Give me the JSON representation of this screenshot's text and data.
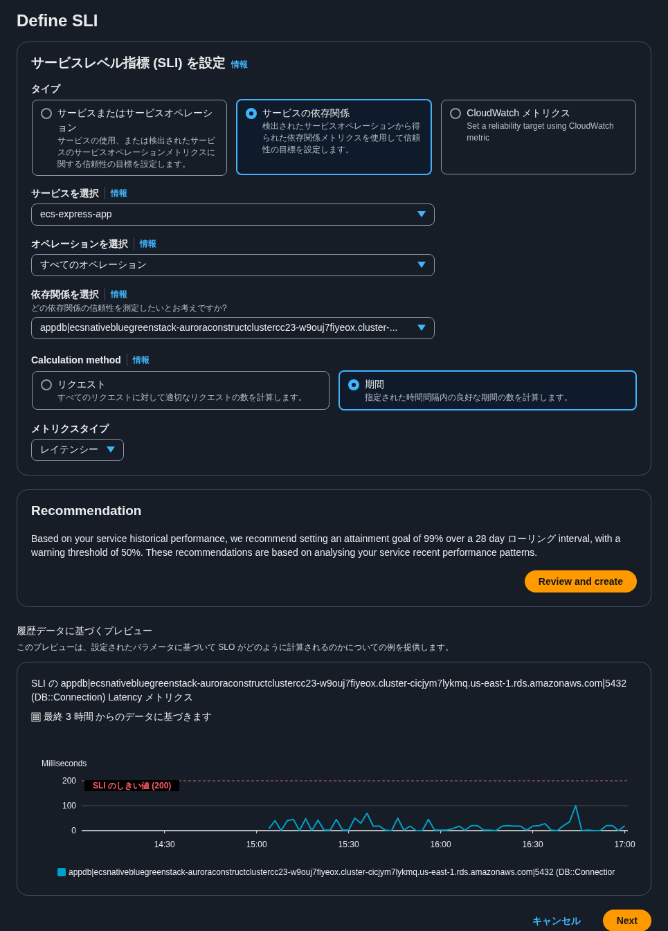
{
  "page_title": "Define SLI",
  "sli_panel": {
    "title": "サービスレベル指標 (SLI) を設定",
    "info": "情報",
    "type_label": "タイプ",
    "type_options": [
      {
        "label": "サービスまたはサービスオペレーション",
        "description": "サービスの使用、または検出されたサービスのサービスオペレーションメトリクスに関する信頼性の目標を設定します。",
        "selected": false
      },
      {
        "label": "サービスの依存関係",
        "description": "検出されたサービスオペレーションから得られた依存関係メトリクスを使用して信頼性の目標を設定します。",
        "selected": true
      },
      {
        "label": "CloudWatch メトリクス",
        "description": "Set a reliability target using CloudWatch metric",
        "selected": false
      }
    ],
    "selects": [
      {
        "label": "サービスを選択",
        "info": "情報",
        "value": "ecs-express-app"
      },
      {
        "label": "オペレーションを選択",
        "info": "情報",
        "value": "すべてのオペレーション"
      },
      {
        "label": "依存関係を選択",
        "info": "情報",
        "hint": "どの依存関係の信頼性を測定したいとお考えですか?",
        "value": "appdb|ecsnativebluegreenstack-auroraconstructclustercc23-w9ouj7fiyeox.cluster-..."
      }
    ],
    "calculation_method": {
      "label": "Calculation method",
      "info": "情報",
      "options": [
        {
          "label": "リクエスト",
          "description": "すべてのリクエストに対して適切なリクエストの数を計算します。",
          "selected": false
        },
        {
          "label": "期間",
          "description": "指定された時間間隔内の良好な期間の数を計算します。",
          "selected": true
        }
      ]
    },
    "metric_type": {
      "label": "メトリクスタイプ",
      "value": "レイテンシー"
    }
  },
  "recommendation": {
    "title": "Recommendation",
    "text": "Based on your service historical performance, we recommend setting an attainment goal of 99% over a 28 day ローリング interval, with a warning threshold of 50%. These recommendations are based on analysing your service recent performance patterns.",
    "button": "Review and create"
  },
  "preview": {
    "title": "履歴データに基づくプレビュー",
    "description": "このプレビューは、設定されたパラメータに基づいて SLO がどのように計算されるのかについての例を提供します。",
    "metric_text": "SLI の appdb|ecsnativebluegreenstack-auroraconstructclustercc23-w9ouj7fiyeox.cluster-cicjym7lykmq.us-east-1.rds.amazonaws.com|5432 (DB::Connection) Latency メトリクス",
    "range_text": "最終 3 時間 からのデータに基づきます",
    "chart_data": {
      "type": "line",
      "ylabel": "Milliseconds",
      "ylim": [
        0,
        200
      ],
      "yticks": [
        0,
        100,
        200
      ],
      "categories": [
        null,
        null,
        null,
        null,
        null,
        null,
        null,
        null,
        null,
        null,
        null,
        null,
        null,
        "14:30",
        null,
        null,
        null,
        null,
        null,
        null,
        null,
        null,
        null,
        null,
        null,
        null,
        null,
        null,
        "15:00",
        null,
        null,
        null,
        null,
        null,
        null,
        null,
        null,
        null,
        null,
        null,
        null,
        null,
        null,
        "15:30",
        null,
        null,
        null,
        null,
        null,
        null,
        null,
        null,
        null,
        null,
        null,
        null,
        null,
        null,
        "16:00",
        null,
        null,
        null,
        null,
        null,
        null,
        null,
        null,
        null,
        null,
        null,
        null,
        null,
        null,
        "16:30",
        null,
        null,
        null,
        null,
        null,
        null,
        null,
        null,
        null,
        null,
        null,
        null,
        null,
        null,
        "17:00"
      ],
      "series": [
        {
          "name": "appdb|ecsnativebluegreenstack-auroraconstructclustercc23-w9ouj7fiyeox.cluster-cicjym7lykmq.us-east-1.rds.amazonaws.com|5432 (DB::Connectior",
          "color": "#00a1c9",
          "values": [
            null,
            null,
            null,
            null,
            null,
            null,
            null,
            null,
            null,
            null,
            null,
            null,
            null,
            null,
            null,
            null,
            null,
            null,
            null,
            null,
            null,
            null,
            null,
            null,
            null,
            null,
            null,
            null,
            null,
            null,
            8,
            40,
            0,
            40,
            45,
            0,
            48,
            0,
            42,
            2,
            2,
            45,
            2,
            2,
            50,
            30,
            70,
            18,
            18,
            2,
            0,
            50,
            2,
            18,
            0,
            0,
            45,
            2,
            2,
            2,
            8,
            18,
            2,
            20,
            20,
            2,
            2,
            0,
            18,
            20,
            18,
            18,
            2,
            18,
            20,
            28,
            2,
            0,
            20,
            35,
            100,
            0,
            2,
            0,
            0,
            20,
            20,
            0,
            20
          ]
        }
      ],
      "annotations": [
        "SLI のしきい値 (200)"
      ]
    }
  },
  "footer": {
    "cancel": "キャンセル",
    "next": "Next"
  }
}
